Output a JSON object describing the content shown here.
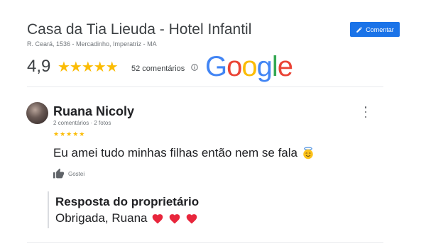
{
  "business": {
    "name": "Casa da Tia Lieuda - Hotel Infantil",
    "address": "R. Ceará, 1536 - Mercadinho, Imperatriz - MA"
  },
  "actions": {
    "comment_label": "Comentar",
    "comment_icon": "pencil-icon"
  },
  "summary": {
    "rating": "4,9",
    "stars": "★★★★★",
    "rating_value": 4.9,
    "rating_max": 5,
    "reviews_count": "52 comentários",
    "info_icon": "info-icon",
    "logo_text": "Google",
    "logo_colors": [
      "#4285f4",
      "#ea4335",
      "#fbbc05",
      "#4285f4",
      "#34a853",
      "#ea4335"
    ]
  },
  "review": {
    "author": "Ruana Nicoly",
    "meta": "2 comentários · 2 fotos",
    "stars": "★★★★★",
    "stars_value": 5,
    "text": "Eu amei tudo minhas filhas então nem se fala",
    "text_emoji": "smiling-face-with-halo",
    "like_label": "Gostei",
    "like_icon": "thumbs-up-icon",
    "menu_icon": "more-vert-icon"
  },
  "owner_reply": {
    "title": "Resposta do proprietário",
    "text": "Obrigada, Ruana",
    "emoji": "red-heart",
    "emoji_count": 3
  },
  "colors": {
    "accent": "#1a73e8",
    "star": "#fbbc04",
    "heart": "#e8263c"
  }
}
